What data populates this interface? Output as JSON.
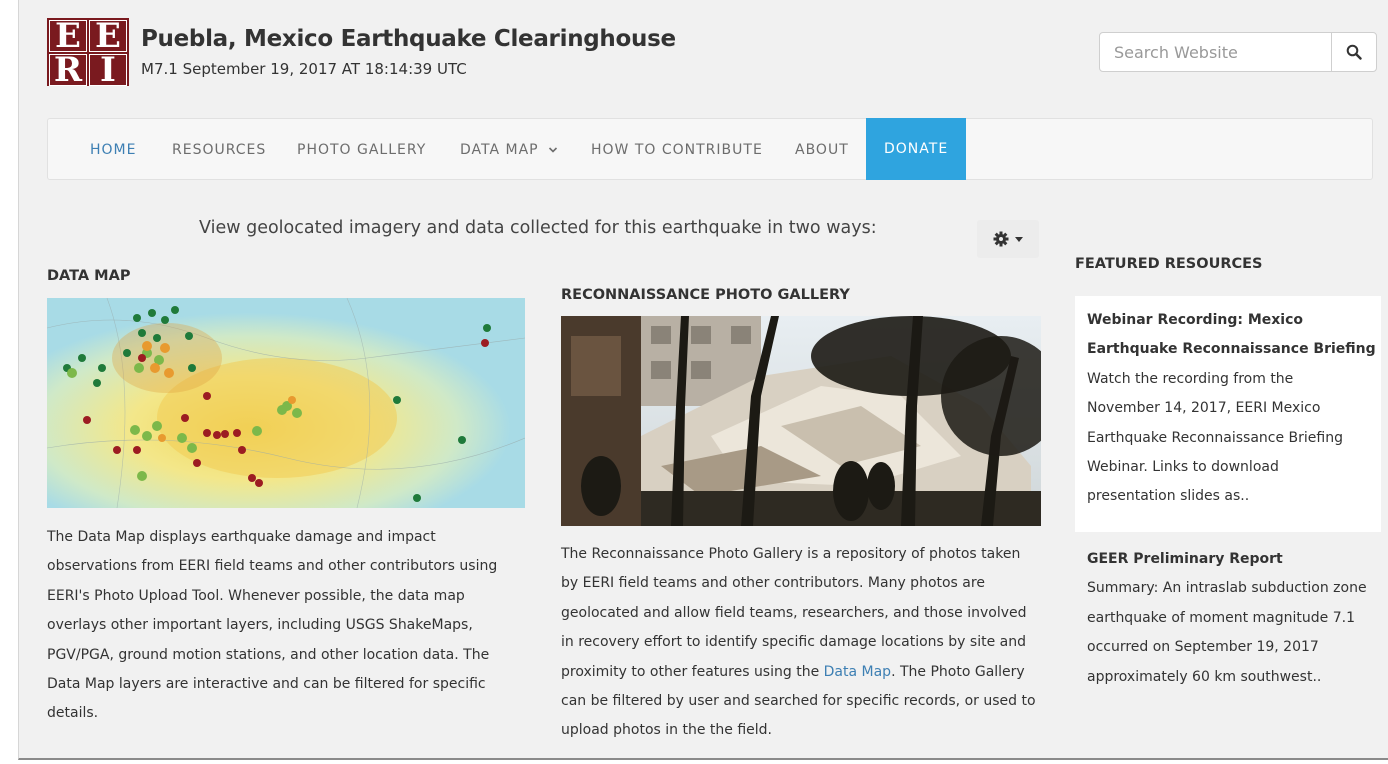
{
  "header": {
    "logo_letters": [
      "E",
      "E",
      "R",
      "I"
    ],
    "title": "Puebla, Mexico Earthquake Clearinghouse",
    "subtitle": "M7.1 September 19, 2017 AT 18:14:39 UTC"
  },
  "search": {
    "placeholder": "Search Website",
    "icon": "search-icon"
  },
  "nav": {
    "items": [
      {
        "label": "HOME"
      },
      {
        "label": "RESOURCES"
      },
      {
        "label": "PHOTO GALLERY"
      },
      {
        "label": "DATA MAP"
      },
      {
        "label": "HOW TO CONTRIBUTE"
      },
      {
        "label": "ABOUT"
      },
      {
        "label": "DONATE"
      }
    ]
  },
  "intro": "View geolocated imagery and data collected for this earthquake in two ways:",
  "settings": {
    "icon": "gear-icon"
  },
  "data_map": {
    "heading": "DATA MAP",
    "lines": [
      "The Data Map displays earthquake damage and impact",
      "observations from EERI field teams and other contributors using",
      "EERI's Photo Upload Tool. Whenever possible, the data map",
      "overlays other important layers, including USGS ShakeMaps,",
      "PGV/PGA, ground motion stations, and other location data. The",
      "Data Map layers are interactive and can be filtered for specific",
      "details."
    ]
  },
  "gallery": {
    "heading": "RECONNAISSANCE PHOTO GALLERY",
    "lines": [
      "The Reconnaissance Photo Gallery is a repository of photos taken",
      "by EERI field teams and other contributors. Many photos are",
      "geolocated and allow field teams, researchers, and those involved",
      "in recovery effort to identify specific damage locations by site and"
    ],
    "line5_before": "proximity to other features using the ",
    "line5_link": "Data Map",
    "line5_after": ". The Photo Gallery",
    "lines_end": [
      "can be filtered by user and searched for specific records, or used to",
      "upload photos in the the field."
    ]
  },
  "featured": {
    "heading": "FEATURED RESOURCES",
    "item1": {
      "title_lines": [
        "Webinar Recording: Mexico",
        "Earthquake Reconnaissance Briefing"
      ],
      "body_lines": [
        "Watch the recording from the",
        "November 14, 2017,  EERI Mexico",
        "Earthquake Reconnaissance Briefing",
        "Webinar. Links to download",
        "presentation slides as.."
      ]
    },
    "item2": {
      "title": "GEER Preliminary Report",
      "body_lines": [
        "Summary: An intraslab subduction zone",
        "earthquake of moment magnitude 7.1",
        "occurred on September 19, 2017",
        "approximately 60 km southwest.."
      ]
    }
  },
  "colors": {
    "accent": "#3d7fb3",
    "donate": "#2fa4df",
    "logo": "#7a1a1f"
  }
}
